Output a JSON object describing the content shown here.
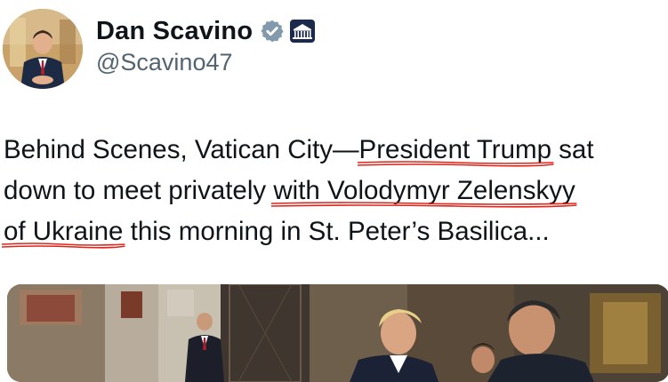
{
  "author": {
    "name": "Dan Scavino",
    "handle": "@Scavino47",
    "verified_icon": "verified-badge-icon",
    "affiliation_icon": "white-house-icon"
  },
  "tweet": {
    "line1": {
      "pre": "Behind Scenes, Vatican City—",
      "u1": "President Trump",
      "post": " sat"
    },
    "line2": {
      "pre": "down to meet privately ",
      "u1": "with Volodymyr Zelenskyy",
      "post": ""
    },
    "line3": {
      "pre": "",
      "u1": "of Ukraine",
      "post": " this morning in St. Peter’s Basilica..."
    }
  },
  "colors": {
    "verified": "#829aab",
    "underline": "#e0251b",
    "text": "#0f1419",
    "handle": "#536471"
  }
}
